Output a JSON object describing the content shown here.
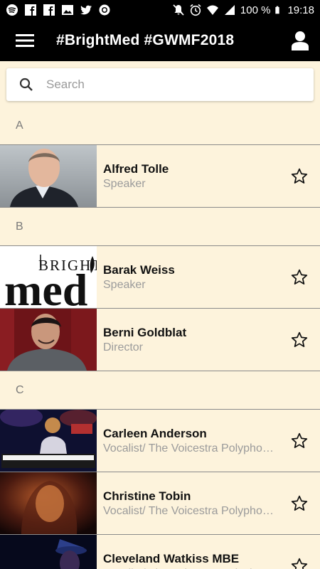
{
  "status_bar": {
    "battery": "100 %",
    "time": "19:18",
    "left_icons": [
      "spotify-icon",
      "facebook-icon",
      "facebook-icon",
      "image-icon",
      "twitter-icon",
      "circle-icon"
    ],
    "right_icons": [
      "mute-icon",
      "alarm-icon",
      "wifi-icon",
      "signal-icon",
      "battery-icon"
    ]
  },
  "app_bar": {
    "title": "#BrightMed #GWMF2018",
    "menu_icon": "hamburger-menu-icon",
    "user_icon": "user-icon"
  },
  "search": {
    "placeholder": "Search",
    "value": ""
  },
  "sections": [
    {
      "letter": "A",
      "people": [
        {
          "name": "Alfred Tolle",
          "role": "Speaker",
          "thumb": "portrait-man-suit"
        }
      ]
    },
    {
      "letter": "B",
      "people": [
        {
          "name": "Barak Weiss",
          "role": "Speaker",
          "thumb": "brightmed-logo",
          "logo_text_top": "BRIGHT",
          "logo_text_bottom": "med"
        },
        {
          "name": "Berni Goldblat",
          "role": "Director",
          "thumb": "portrait-man-red-curtain"
        }
      ]
    },
    {
      "letter": "C",
      "people": [
        {
          "name": "Carleen Anderson",
          "role": "Vocalist/ The Voicestra Polyphonic",
          "thumb": "stage-keyboard"
        },
        {
          "name": "Christine Tobin",
          "role": "Vocalist/ The Voicestra Polyphonic",
          "thumb": "portrait-dark-orange"
        },
        {
          "name": "Cleveland Watkiss MBE",
          "role": "Vocalist/ The Voicestra Polyphonic",
          "thumb": "portrait-hat-blue"
        }
      ]
    }
  ],
  "colors": {
    "background": "#fdf3dc",
    "bar": "#000000",
    "divider": "#8a8a8a",
    "secondary_text": "#9b9b9b"
  }
}
